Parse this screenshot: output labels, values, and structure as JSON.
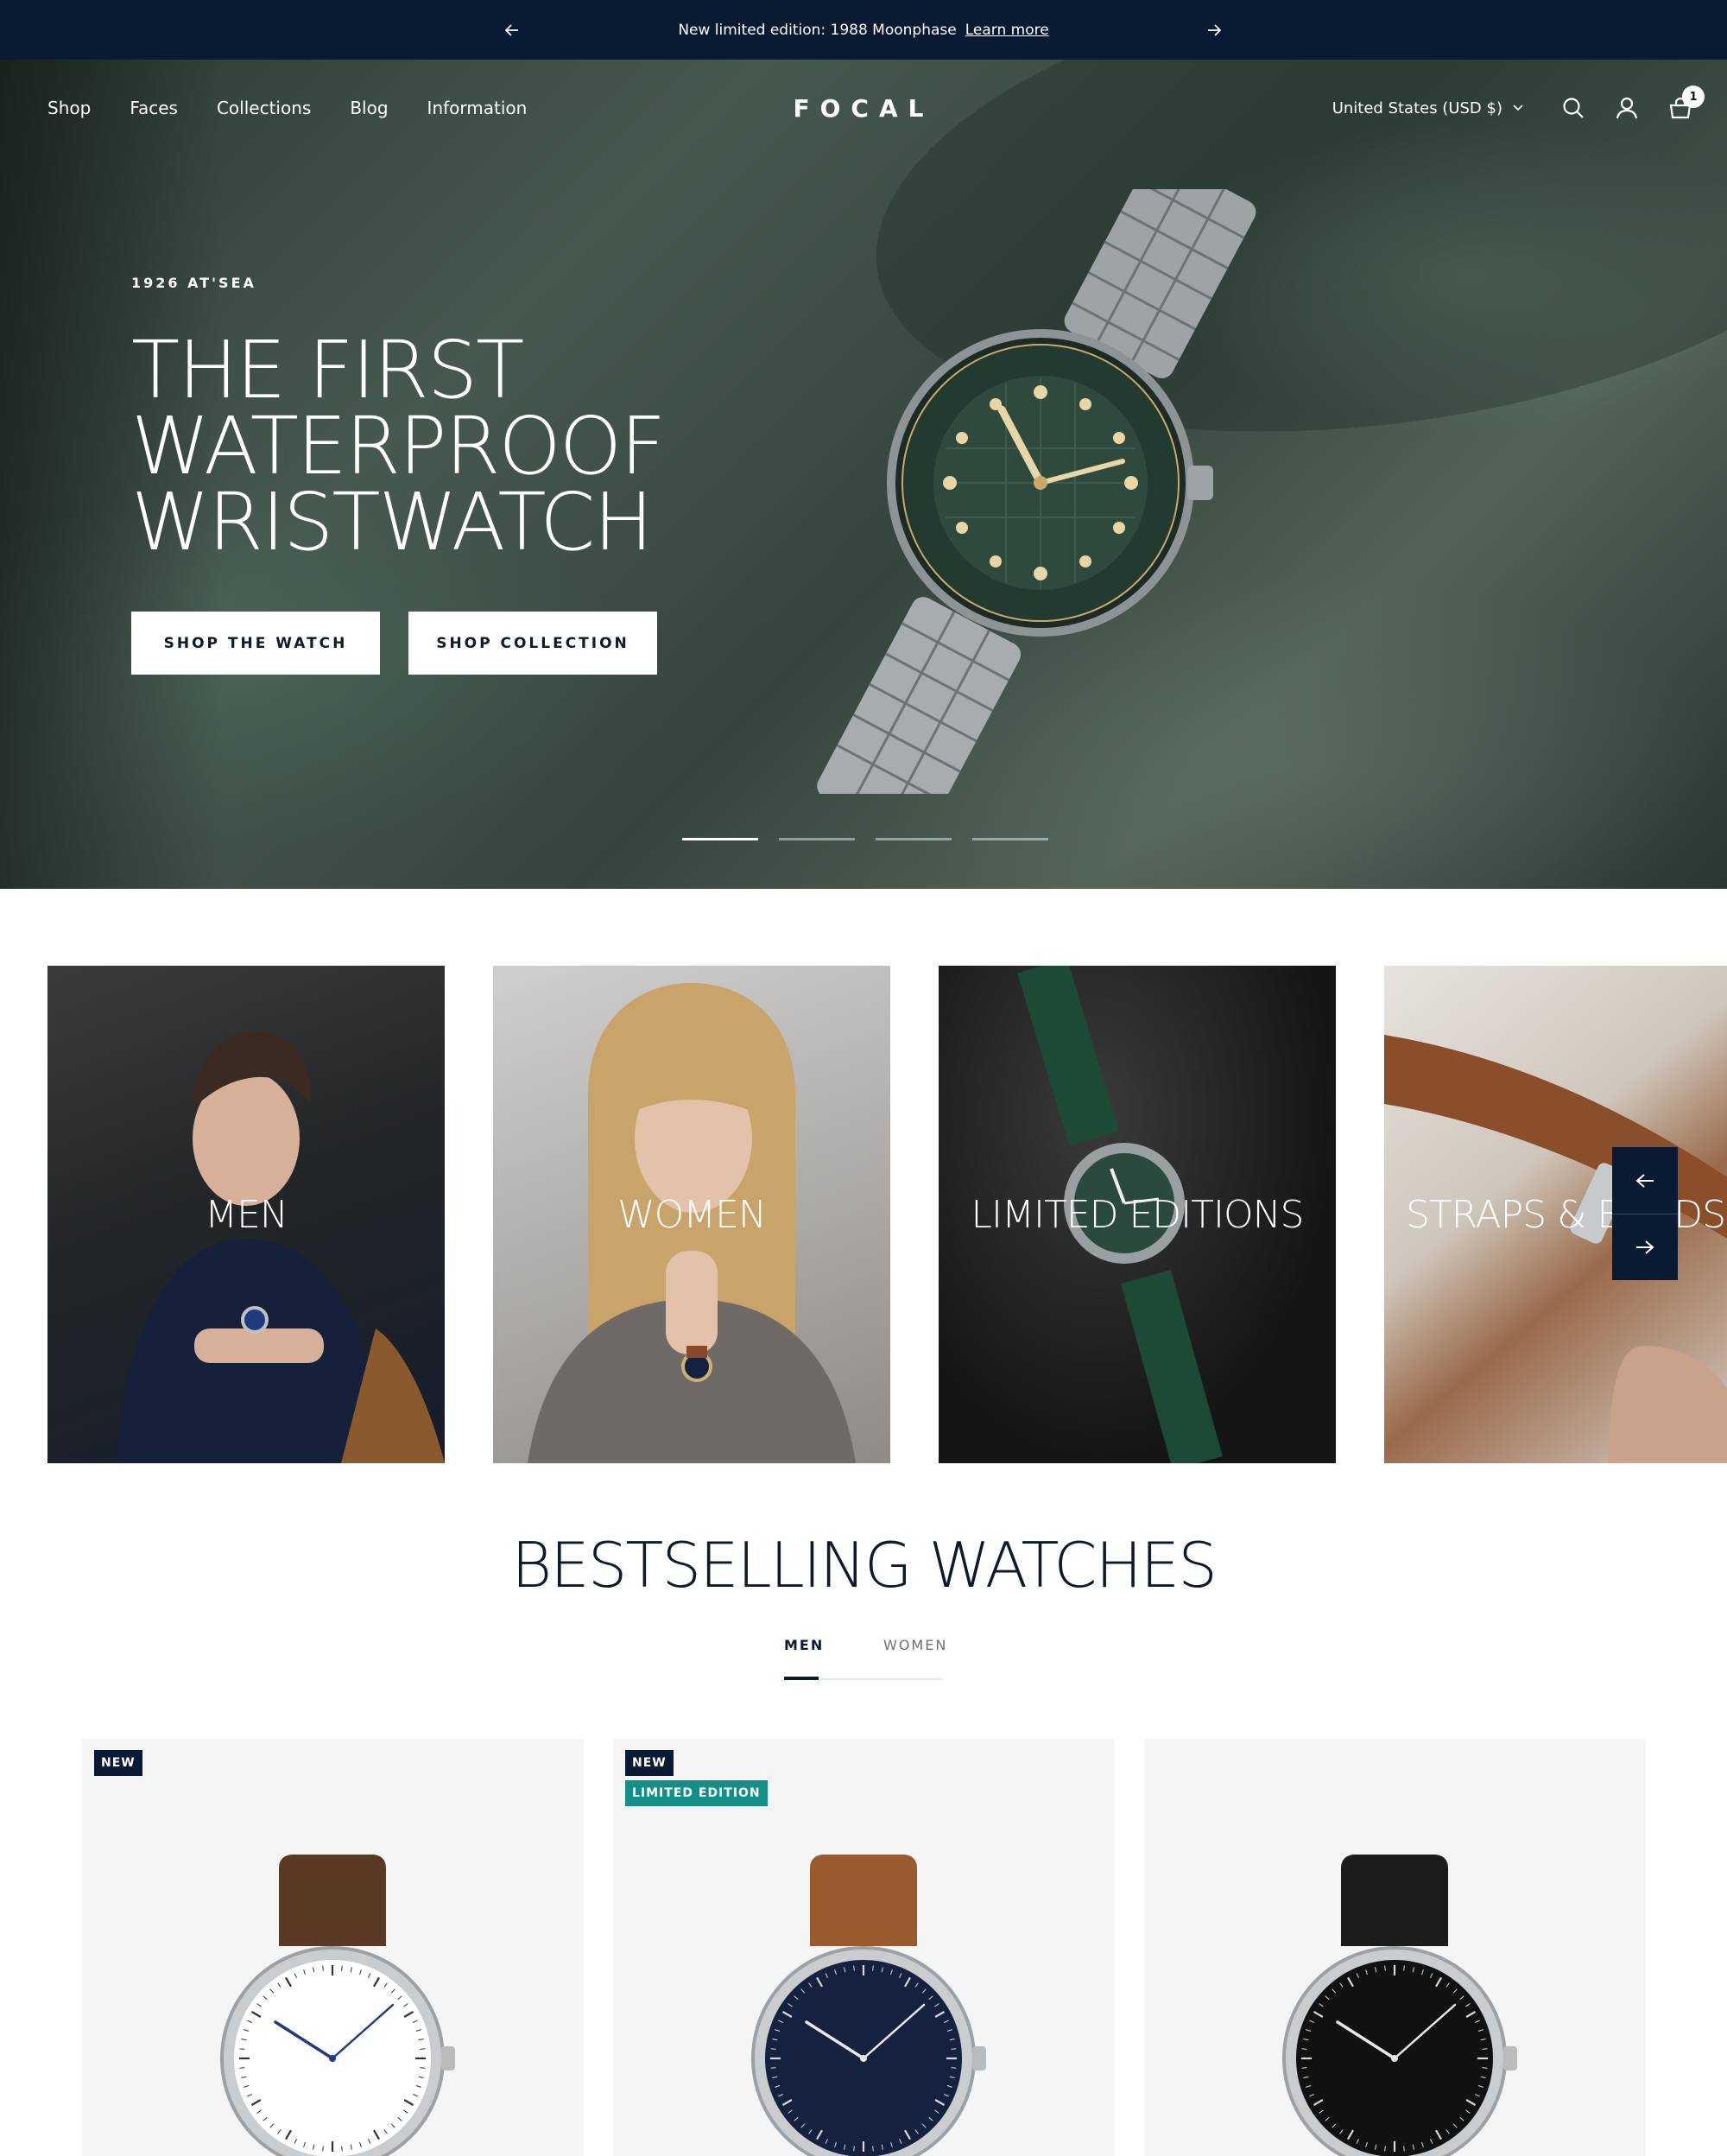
{
  "announcement": {
    "message": "New limited edition: 1988 Moonphase",
    "link": "Learn more"
  },
  "nav": {
    "links": [
      "Shop",
      "Faces",
      "Collections",
      "Blog",
      "Information"
    ],
    "logo": "FOCAL",
    "country": "United States (USD $)",
    "cart_count": "1"
  },
  "hero": {
    "eyebrow": "1926 AT'SEA",
    "title_lines": [
      "THE FIRST",
      "WATERPROOF",
      "WRISTWATCH"
    ],
    "buttons": [
      "SHOP THE WATCH",
      "SHOP COLLECTION"
    ],
    "slide_count": 4,
    "active_slide": 1
  },
  "collections": [
    {
      "label": "MEN"
    },
    {
      "label": "WOMEN"
    },
    {
      "label": "LIMITED EDITIONS"
    },
    {
      "label": "STRAPS & BANDS"
    }
  ],
  "bestselling": {
    "title": "BESTSELLING WATCHES",
    "tabs": [
      "MEN",
      "WOMEN"
    ],
    "active_tab": "MEN",
    "products": [
      {
        "badges": [
          "NEW"
        ],
        "dial_color": "#ffffff",
        "strap_color": "#5a3a24",
        "hand_color": "#1e3a8a"
      },
      {
        "badges": [
          "NEW",
          "LIMITED EDITION"
        ],
        "dial_color": "#15223f",
        "strap_color": "#9a5a2e",
        "hand_color": "#e8e8e8"
      },
      {
        "badges": [],
        "dial_color": "#111111",
        "strap_color": "#1c1c1c",
        "hand_color": "#e8e8e8"
      }
    ]
  },
  "colors": {
    "navy": "#0b1a33",
    "teal_badge": "#138f86"
  },
  "icons": [
    "arrow-left-icon",
    "arrow-right-icon",
    "chevron-down-icon",
    "search-icon",
    "account-icon",
    "cart-icon"
  ]
}
